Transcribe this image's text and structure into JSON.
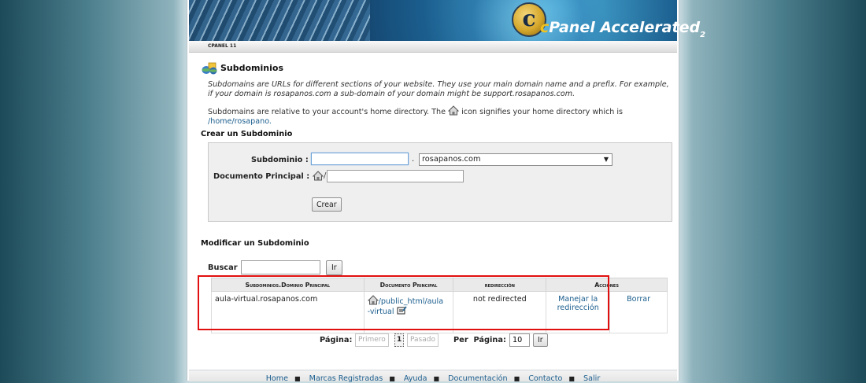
{
  "banner": {
    "brand_c": "c",
    "brand_rest": "Panel",
    "brand_accel": "Accelerated",
    "brand_sub": "2",
    "version_bar": "CPANEL 11"
  },
  "page": {
    "title": "Subdominios",
    "desc_1": "Subdomains are URLs for different sections of your website. They use your main domain name and a prefix. For example, if your domain is rosapanos.com a sub-domain of your domain might be support.rosapanos.com.",
    "desc_2a": "Subdomains are relative to your account's home directory. The",
    "desc_2b": "icon signifies your home directory which is",
    "home_path": "/home/rosapano."
  },
  "create": {
    "heading": "Crear un Subdominio",
    "sub_label": "Subdominio :",
    "sub_value": "",
    "dot": ".",
    "domain_selected": "rosapanos.com",
    "doc_label": "Documento Principal :",
    "doc_slash": "/",
    "doc_value": "",
    "create_button": "Crear"
  },
  "modify": {
    "heading": "Modificar un Subdominio",
    "search_label": "Buscar",
    "search_value": "",
    "search_button": "Ir",
    "columns": [
      "Subdominios.Dominio Principal",
      "Documento Principal",
      "redirección",
      "Acciones"
    ],
    "rows": [
      {
        "subdomain": "aula-virtual.rosapanos.com",
        "doc_line1": "/public_html/aula",
        "doc_line2": "-virtual",
        "redirect": "not redirected",
        "action_manage": "Manejar la redirección",
        "action_delete": "Borrar"
      }
    ]
  },
  "pagination": {
    "page_label": "Página:",
    "first": "Primero",
    "current": "1",
    "prev": "Pasado",
    "per_page_label": "Per  Página:",
    "per_page_value": "10",
    "go_button": "Ir"
  },
  "footer": {
    "links": [
      "Home",
      "Marcas Registradas",
      "Ayuda",
      "Documentación",
      "Contacto",
      "Salir"
    ]
  },
  "colors": {
    "accent": "#1b5e8e",
    "highlight_border": "#e10f0f",
    "banner_dark": "#0e2f52",
    "logo_gold": "#d6a82c"
  }
}
